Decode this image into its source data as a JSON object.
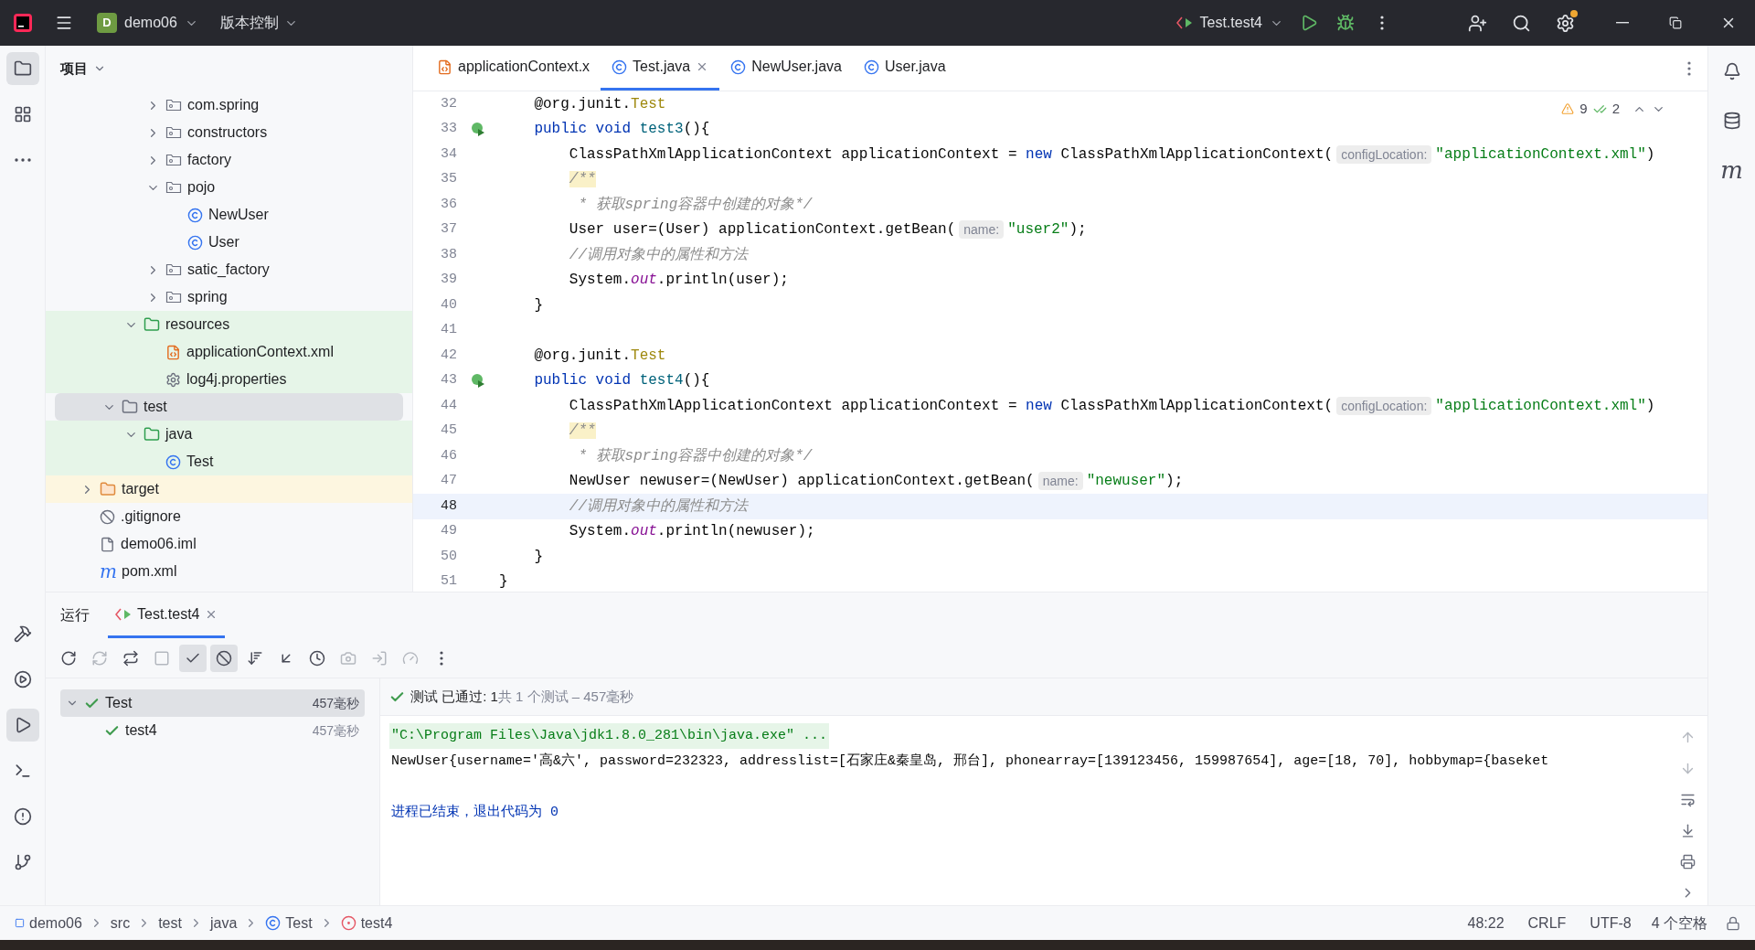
{
  "title_bar": {
    "project_badge": "D",
    "project": "demo06",
    "vcs": "版本控制",
    "run_config": "Test.test4",
    "settings_notice": true
  },
  "left_toolbar_top": [
    {
      "kind": "folder",
      "selected": true
    },
    {
      "kind": "structure",
      "selected": false
    },
    {
      "kind": "more",
      "selected": false
    }
  ],
  "left_toolbar_bottom": [
    {
      "kind": "build",
      "selected": false
    },
    {
      "kind": "services",
      "selected": false
    },
    {
      "kind": "run",
      "selected": true
    },
    {
      "kind": "terminal",
      "selected": false
    },
    {
      "kind": "problems",
      "selected": false
    },
    {
      "kind": "git",
      "selected": false
    }
  ],
  "project_panel": {
    "title": "项目",
    "tree": [
      {
        "kind": "continued",
        "children": [
          {
            "kind": "continued",
            "children": [
              {
                "kind": "continued",
                "children": [
                  {
                    "label": "com.spring",
                    "kind": "package",
                    "expanded": false,
                    "selected": false
                  },
                  {
                    "label": "constructors",
                    "kind": "package",
                    "expanded": false,
                    "selected": false
                  },
                  {
                    "label": "factory",
                    "kind": "package",
                    "expanded": false,
                    "selected": false
                  },
                  {
                    "label": "pojo",
                    "kind": "package",
                    "expanded": true,
                    "selected": false,
                    "children": [
                      {
                        "label": "NewUser",
                        "kind": "class",
                        "selected": false
                      },
                      {
                        "label": "User",
                        "kind": "class",
                        "selected": false
                      }
                    ]
                  },
                  {
                    "label": "satic_factory",
                    "kind": "package",
                    "expanded": false,
                    "selected": false
                  },
                  {
                    "label": "spring",
                    "kind": "package",
                    "expanded": false,
                    "selected": false
                  }
                ]
              },
              {
                "label": "resources",
                "kind": "resources",
                "expanded": true,
                "selected": false,
                "color": "#e6f5e8",
                "children": [
                  {
                    "label": "applicationContext.xml",
                    "kind": "xml",
                    "selected": false,
                    "color": "#e6f5e8"
                  },
                  {
                    "label": "log4j.properties",
                    "kind": "properties",
                    "selected": false,
                    "color": "#e6f5e8"
                  }
                ]
              }
            ]
          },
          {
            "label": "test",
            "kind": "folder",
            "expanded": true,
            "selected": true,
            "children": [
              {
                "label": "java",
                "kind": "test-root",
                "expanded": true,
                "selected": false,
                "color": "#e6f5e8",
                "children": [
                  {
                    "label": "Test",
                    "kind": "class",
                    "selected": false,
                    "color": "#e6f5e8"
                  }
                ]
              }
            ]
          }
        ]
      },
      {
        "label": "target",
        "kind": "excluded",
        "expanded": false,
        "selected": false,
        "color": "#fdf6e0"
      },
      {
        "label": ".gitignore",
        "kind": "ignore",
        "selected": false
      },
      {
        "label": "demo06.iml",
        "kind": "iml",
        "selected": false
      },
      {
        "label": "pom.xml",
        "kind": "maven",
        "glyph": "m",
        "selected": false
      }
    ]
  },
  "editor_tabs": [
    {
      "label": "applicationContext.x",
      "kind": "xml",
      "selected": false,
      "closable": false
    },
    {
      "label": "Test.java",
      "kind": "class",
      "selected": true,
      "closable": true
    },
    {
      "label": "NewUser.java",
      "kind": "class",
      "selected": false,
      "closable": false
    },
    {
      "label": "User.java",
      "kind": "class",
      "selected": false,
      "closable": false
    }
  ],
  "inspections": {
    "warnings": "9",
    "weak_warnings": "2"
  },
  "code": [
    {
      "number": "32",
      "current": false,
      "run_icon": false,
      "tokens": [
        {
          "kind": "plain",
          "text": "    @org.junit."
        },
        {
          "kind": "annotation",
          "text": "Test"
        }
      ]
    },
    {
      "number": "33",
      "current": false,
      "run_icon": true,
      "tokens": [
        {
          "kind": "keyword",
          "text": "    public void "
        },
        {
          "kind": "declaration",
          "text": "test3"
        },
        {
          "kind": "plain",
          "text": "(){"
        }
      ]
    },
    {
      "number": "34",
      "current": false,
      "run_icon": false,
      "tokens": [
        {
          "kind": "plain",
          "text": "        ClassPathXmlApplicationContext applicationContext = "
        },
        {
          "kind": "keyword",
          "text": "new"
        },
        {
          "kind": "plain",
          "text": " ClassPathXmlApplicationContext("
        },
        {
          "kind": "hint",
          "text": "configLocation:"
        },
        {
          "kind": "string",
          "text": "\"applicationContext.xml\""
        },
        {
          "kind": "plain",
          "text": ")"
        }
      ]
    },
    {
      "number": "35",
      "current": false,
      "run_icon": false,
      "tokens": [
        {
          "kind": "doc",
          "text": "        /**"
        }
      ]
    },
    {
      "number": "36",
      "current": false,
      "run_icon": false,
      "tokens": [
        {
          "kind": "comment",
          "text": "         * 获取spring容器中创建的对象*/"
        }
      ]
    },
    {
      "number": "37",
      "current": false,
      "run_icon": false,
      "tokens": [
        {
          "kind": "plain",
          "text": "        User user=(User) applicationContext.getBean("
        },
        {
          "kind": "hint",
          "text": "name:"
        },
        {
          "kind": "string",
          "text": "\"user2\""
        },
        {
          "kind": "plain",
          "text": ");"
        }
      ]
    },
    {
      "number": "38",
      "current": false,
      "run_icon": false,
      "tokens": [
        {
          "kind": "comment",
          "text": "        //调用对象中的属性和方法"
        }
      ]
    },
    {
      "number": "39",
      "current": false,
      "run_icon": false,
      "tokens": [
        {
          "kind": "plain",
          "text": "        System."
        },
        {
          "kind": "static",
          "text": "out"
        },
        {
          "kind": "plain",
          "text": ".println(user);"
        }
      ]
    },
    {
      "number": "40",
      "current": false,
      "run_icon": false,
      "tokens": [
        {
          "kind": "plain",
          "text": "    }"
        }
      ]
    },
    {
      "number": "41",
      "current": false,
      "run_icon": false
    },
    {
      "number": "42",
      "current": false,
      "run_icon": false,
      "tokens": [
        {
          "kind": "plain",
          "text": "    @org.junit."
        },
        {
          "kind": "annotation",
          "text": "Test"
        }
      ]
    },
    {
      "number": "43",
      "current": false,
      "run_icon": true,
      "tokens": [
        {
          "kind": "keyword",
          "text": "    public void "
        },
        {
          "kind": "declaration",
          "text": "test4"
        },
        {
          "kind": "plain",
          "text": "(){"
        }
      ]
    },
    {
      "number": "44",
      "current": false,
      "run_icon": false,
      "tokens": [
        {
          "kind": "plain",
          "text": "        ClassPathXmlApplicationContext applicationContext = "
        },
        {
          "kind": "keyword",
          "text": "new"
        },
        {
          "kind": "plain",
          "text": " ClassPathXmlApplicationContext("
        },
        {
          "kind": "hint",
          "text": "configLocation:"
        },
        {
          "kind": "string",
          "text": "\"applicationContext.xml\""
        },
        {
          "kind": "plain",
          "text": ")"
        }
      ]
    },
    {
      "number": "45",
      "current": false,
      "run_icon": false,
      "tokens": [
        {
          "kind": "doc",
          "text": "        /**"
        }
      ]
    },
    {
      "number": "46",
      "current": false,
      "run_icon": false,
      "tokens": [
        {
          "kind": "comment",
          "text": "         * 获取spring容器中创建的对象*/"
        }
      ]
    },
    {
      "number": "47",
      "current": false,
      "run_icon": false,
      "tokens": [
        {
          "kind": "plain",
          "text": "        NewUser newuser=(NewUser) applicationContext.getBean("
        },
        {
          "kind": "hint",
          "text": "name:"
        },
        {
          "kind": "string",
          "text": "\"newuser\""
        },
        {
          "kind": "plain",
          "text": ");"
        }
      ]
    },
    {
      "number": "48",
      "current": true,
      "run_icon": false,
      "tokens": [
        {
          "kind": "comment",
          "text": "        //调用对象中的属性和方法"
        }
      ]
    },
    {
      "number": "49",
      "current": false,
      "run_icon": false,
      "tokens": [
        {
          "kind": "plain",
          "text": "        System."
        },
        {
          "kind": "static",
          "text": "out"
        },
        {
          "kind": "plain",
          "text": ".println(newuser);"
        }
      ]
    },
    {
      "number": "50",
      "current": false,
      "run_icon": false,
      "tokens": [
        {
          "kind": "plain",
          "text": "    }"
        }
      ]
    },
    {
      "number": "51",
      "current": false,
      "run_icon": false,
      "tokens": [
        {
          "kind": "plain",
          "text": "}"
        }
      ]
    }
  ],
  "right_toolbar": [
    {
      "kind": "bell"
    },
    {
      "kind": "database"
    },
    {
      "kind": "maven",
      "glyph": "m"
    }
  ],
  "run_panel": {
    "title": "运行",
    "tabs": [
      {
        "label": "Test.test4",
        "selected": true
      }
    ],
    "toolbar": [
      {
        "kind": "rerun",
        "on": false,
        "disabled": false
      },
      {
        "kind": "rerun-failed",
        "on": false,
        "disabled": true
      },
      {
        "kind": "toggle-auto",
        "on": false,
        "disabled": false
      },
      {
        "kind": "stop",
        "on": false,
        "disabled": true
      },
      {
        "kind": "show-passed",
        "on": true,
        "disabled": false
      },
      {
        "kind": "show-ignored",
        "on": true,
        "disabled": false
      },
      {
        "kind": "sort",
        "on": false,
        "disabled": false
      },
      {
        "kind": "import",
        "on": false,
        "disabled": false
      },
      {
        "kind": "history",
        "on": false,
        "disabled": false
      },
      {
        "kind": "camera",
        "on": false,
        "disabled": true
      },
      {
        "kind": "export",
        "on": false,
        "disabled": true
      },
      {
        "kind": "gauge",
        "on": false,
        "disabled": true
      },
      {
        "kind": "more",
        "on": false,
        "disabled": false
      }
    ],
    "tests": [
      {
        "name": "Test",
        "time": "457毫秒",
        "passed": true,
        "expanded": true,
        "selected": true,
        "children": [
          {
            "name": "test4",
            "time": "457毫秒",
            "passed": true,
            "selected": false
          }
        ]
      }
    ],
    "summary": {
      "passed": true,
      "status": "测试 已通过: 1",
      "detail": "共 1 个测试 – 457毫秒"
    },
    "console": [
      {
        "kind": "command",
        "text": "\"C:\\Program Files\\Java\\jdk1.8.0_281\\bin\\java.exe\" ..."
      },
      {
        "kind": "output",
        "text": "NewUser{username='高&六', password=232323, addresslist=[石家庄&秦皇岛, 邢台], phonearray=[139123456, 159987654], age=[18, 70], hobbymap={baseket"
      },
      {
        "kind": "exit",
        "text": "进程已结束，退出代码为 0"
      }
    ],
    "console_tools": [
      {
        "kind": "up",
        "disabled": true
      },
      {
        "kind": "down",
        "disabled": true
      },
      {
        "kind": "wrap",
        "disabled": false
      },
      {
        "kind": "scroll-end",
        "disabled": false
      },
      {
        "kind": "print",
        "disabled": false
      },
      {
        "kind": "expand",
        "disabled": false
      }
    ]
  },
  "status_bar": {
    "breadcrumbs": [
      {
        "label": "demo06",
        "kind": "module"
      },
      {
        "label": "src"
      },
      {
        "label": "test"
      },
      {
        "label": "java"
      },
      {
        "label": "Test",
        "kind": "class"
      },
      {
        "label": "test4",
        "kind": "method"
      }
    ],
    "position": "48:22",
    "line_separator": "CRLF",
    "encoding": "UTF-8",
    "indent": "4 个空格"
  }
}
